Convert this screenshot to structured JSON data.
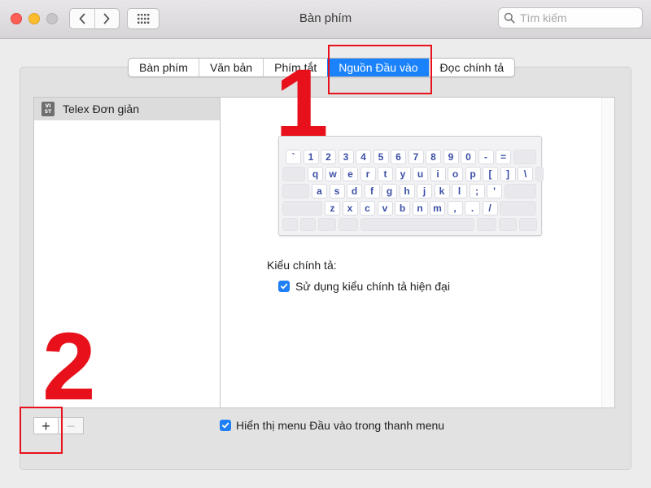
{
  "window": {
    "title": "Bàn phím",
    "search_placeholder": "Tìm kiếm"
  },
  "icons": {
    "back": "chevron-left-icon",
    "forward": "chevron-right-icon",
    "show_all": "grid-icon",
    "search": "search-icon",
    "checkmark": "checkmark-icon"
  },
  "tabs": [
    {
      "label": "Bàn phím",
      "active": false
    },
    {
      "label": "Văn bản",
      "active": false
    },
    {
      "label": "Phím tắt",
      "active": false
    },
    {
      "label": "Nguồn Đầu vào",
      "active": true
    },
    {
      "label": "Đọc chính tả",
      "active": false
    }
  ],
  "sources": [
    {
      "label": "Telex Đơn giản",
      "icon_text": [
        "VI",
        "ST"
      ],
      "selected": true
    }
  ],
  "keyboard": {
    "rows": [
      [
        "`",
        "1",
        "2",
        "3",
        "4",
        "5",
        "6",
        "7",
        "8",
        "9",
        "0",
        "-",
        "="
      ],
      [
        "q",
        "w",
        "e",
        "r",
        "t",
        "y",
        "u",
        "i",
        "o",
        "p",
        "[",
        "]",
        "\\"
      ],
      [
        "a",
        "s",
        "d",
        "f",
        "g",
        "h",
        "j",
        "k",
        "l",
        ";",
        "'"
      ],
      [
        "z",
        "x",
        "c",
        "v",
        "b",
        "n",
        "m",
        ",",
        ".",
        "/"
      ]
    ]
  },
  "spelling": {
    "label": "Kiểu chính tả:",
    "modern_checkbox_label": "Sử dụng kiểu chính tả hiện đại",
    "modern_checked": true
  },
  "bottom": {
    "add_label": "+",
    "remove_label": "−",
    "show_menu_label": "Hiển thị menu Đầu vào trong thanh menu",
    "show_menu_checked": true
  },
  "annotations": {
    "step1": "1",
    "step2": "2"
  },
  "colors": {
    "accent": "#1a82fb",
    "annotation": "#e8111b",
    "key_text": "#3b4fa6"
  }
}
